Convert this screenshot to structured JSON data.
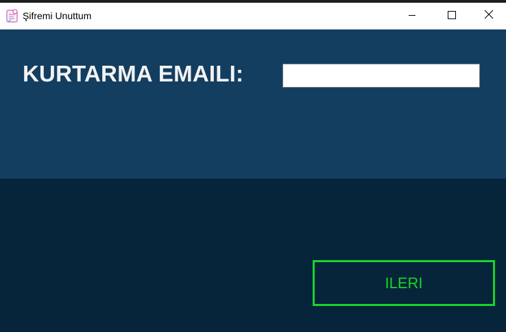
{
  "window": {
    "title": "Şifremi Unuttum",
    "app_icon": "forgot-password-app-icon",
    "controls": {
      "minimize_icon": "minimize-icon",
      "maximize_icon": "maximize-icon",
      "close_icon": "close-icon"
    }
  },
  "form": {
    "email_label": "KURTARMA EMAILI:",
    "email_value": "",
    "email_placeholder": "",
    "next_button_label": "ILERI"
  },
  "colors": {
    "top_panel": "#133e60",
    "bottom_panel": "#06243a",
    "label_text": "#f2f2f2",
    "button_accent": "#17d629"
  }
}
